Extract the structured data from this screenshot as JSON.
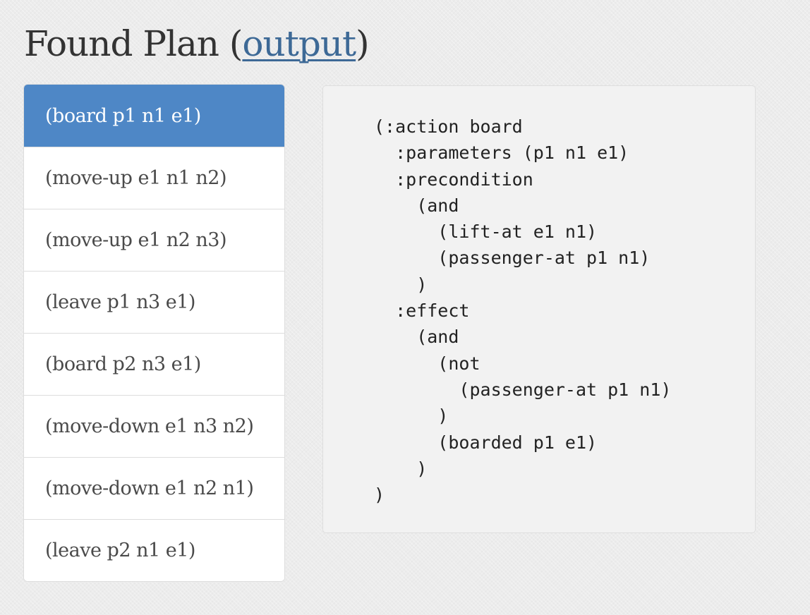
{
  "header": {
    "title_prefix": "Found Plan (",
    "output_link": "output",
    "title_suffix": ")"
  },
  "plan": {
    "active_index": 0,
    "steps": [
      "(board p1 n1 e1)",
      "(move-up e1 n1 n2)",
      "(move-up e1 n2 n3)",
      "(leave p1 n3 e1)",
      "(board p2 n3 e1)",
      "(move-down e1 n3 n2)",
      "(move-down e1 n2 n1)",
      "(leave p2 n1 e1)"
    ]
  },
  "action_detail": {
    "code": "(:action board\n  :parameters (p1 n1 e1)\n  :precondition\n    (and\n      (lift-at e1 n1)\n      (passenger-at p1 n1)\n    )\n  :effect\n    (and\n      (not\n        (passenger-at p1 n1)\n      )\n      (boarded p1 e1)\n    )\n)"
  },
  "colors": {
    "active_item": "#4e87c6",
    "link": "#3d6996"
  }
}
